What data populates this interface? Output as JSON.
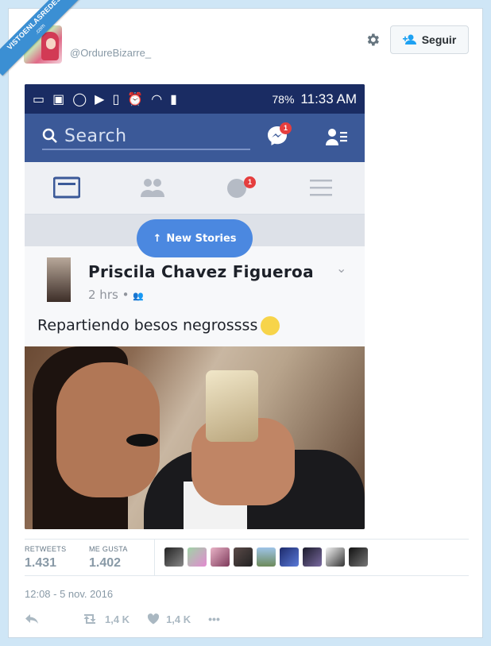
{
  "watermark": {
    "line1": "VISTOENLASREDES",
    "line2": ".com"
  },
  "tweet": {
    "handle": "@OrdureBizarre_",
    "follow_label": "Seguir",
    "timestamp": "12:08 - 5 nov. 2016",
    "stats": {
      "retweets_label": "RETWEETS",
      "retweets_value": "1.431",
      "likes_label": "ME GUSTA",
      "likes_value": "1.402"
    },
    "likers_count_shown": 9,
    "actions": {
      "retweet_count": "1,4 K",
      "like_count": "1,4 K",
      "more": "•••"
    }
  },
  "screenshot": {
    "status_bar": {
      "battery": "78%",
      "time": "11:33 AM"
    },
    "fb": {
      "search_placeholder": "Search",
      "messenger_badge": "1",
      "globe_badge": "1",
      "new_stories_label": "New Stories",
      "post": {
        "author": "Priscila Chavez Figueroa",
        "meta": "2 hrs •",
        "text": "Repartiendo besos negrossss"
      }
    }
  },
  "colors": {
    "accent": "#1da1f2",
    "facebook": "#3b5998",
    "ribbon": "#3b8fd3"
  }
}
